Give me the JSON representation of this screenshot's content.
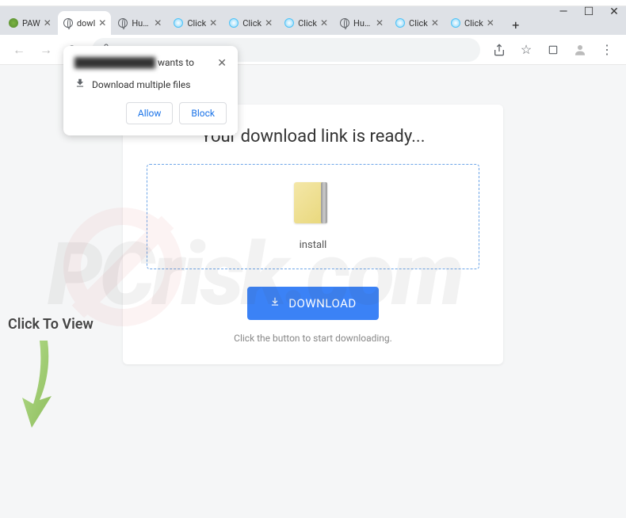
{
  "window": {
    "minimize": "—",
    "maximize": "☐",
    "close": "✕"
  },
  "tabs": [
    {
      "title": "PAW",
      "favicon": "green"
    },
    {
      "title": "dowl",
      "favicon": "globe",
      "active": true
    },
    {
      "title": "Huma",
      "favicon": "globe"
    },
    {
      "title": "Click",
      "favicon": "cyan"
    },
    {
      "title": "Click",
      "favicon": "cyan"
    },
    {
      "title": "Click",
      "favicon": "cyan"
    },
    {
      "title": "Huma",
      "favicon": "globe"
    },
    {
      "title": "Click",
      "favicon": "cyan"
    },
    {
      "title": "Click",
      "favicon": "cyan"
    }
  ],
  "permission": {
    "origin_suffix": "wants to",
    "message": "Download multiple files",
    "allow": "Allow",
    "block": "Block"
  },
  "page": {
    "heading": "Your download link is ready...",
    "filename": "install",
    "download_button": "DOWNLOAD",
    "hint": "Click the button to start downloading."
  },
  "overlay": {
    "click_to_view": "Click To View"
  }
}
